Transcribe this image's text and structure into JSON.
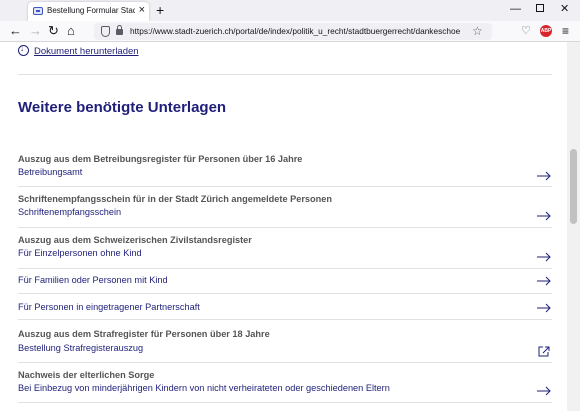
{
  "browser": {
    "tab_title": "Bestellung Formular Stadtbürgerrecht",
    "url": "https://www.stadt-zuerich.ch/portal/de/index/politik_u_recht/stadtbuergerrecht/dankeschoen"
  },
  "page": {
    "download_label": "Dokument herunterladen",
    "section_title": "Weitere benötigte Unterlagen",
    "items": [
      {
        "heading": "Auszug aus dem Betreibungsregister für Personen über 16 Jahre",
        "link": "Betreibungsamt",
        "icon": "arrow-right-icon"
      },
      {
        "heading": "Schriftenempfangsschein für in der Stadt Zürich angemeldete Personen",
        "link": "Schriftenempfangsschein",
        "icon": "arrow-right-icon"
      },
      {
        "heading": "Auszug aus dem Schweizerischen Zivilstandsregister",
        "link": "Für Einzelpersonen ohne Kind",
        "icon": "arrow-right-icon"
      },
      {
        "heading": "",
        "link": "Für Familien oder Personen mit Kind",
        "icon": "arrow-right-icon"
      },
      {
        "heading": "",
        "link": "Für Personen in eingetragener Partnerschaft",
        "icon": "arrow-right-icon"
      },
      {
        "heading": "Auszug aus dem Strafregister für Personen über 18 Jahre",
        "link": "Bestellung Strafregisterauszug",
        "icon": "external-link-icon"
      },
      {
        "heading": "Nachweis der elterlichen Sorge",
        "link": "Bei Einbezug von minderjährigen Kindern von nicht verheirateten oder geschiedenen Eltern",
        "icon": "arrow-right-icon"
      }
    ]
  },
  "colors": {
    "accent": "#1f1f7a",
    "heading": "#555555",
    "divider": "#e2e2e2"
  }
}
